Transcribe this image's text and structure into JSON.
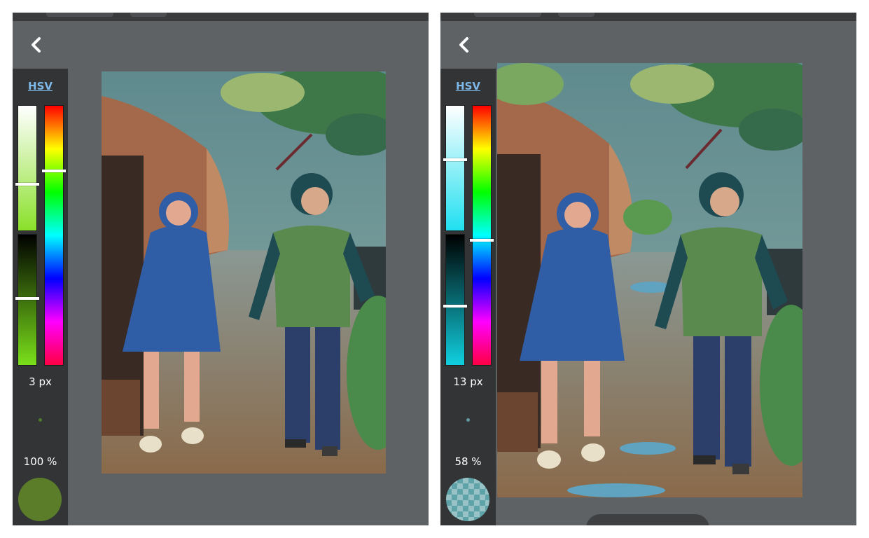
{
  "left_panel": {
    "back_icon": "chevron-left-icon",
    "color_mode_label": "HSV",
    "brush_size": "3 px",
    "opacity": "100 %",
    "current_color": "#5b7d2a",
    "saturation_level": 0.63,
    "value_level": 0.49,
    "hue_level": 0.25
  },
  "right_panel": {
    "back_icon": "chevron-left-icon",
    "color_mode_label": "HSV",
    "brush_size": "13 px",
    "opacity": "58 %",
    "current_color": "#5fa3a8",
    "saturation_level": 0.43,
    "value_level": 0.55,
    "hue_level": 0.52
  }
}
